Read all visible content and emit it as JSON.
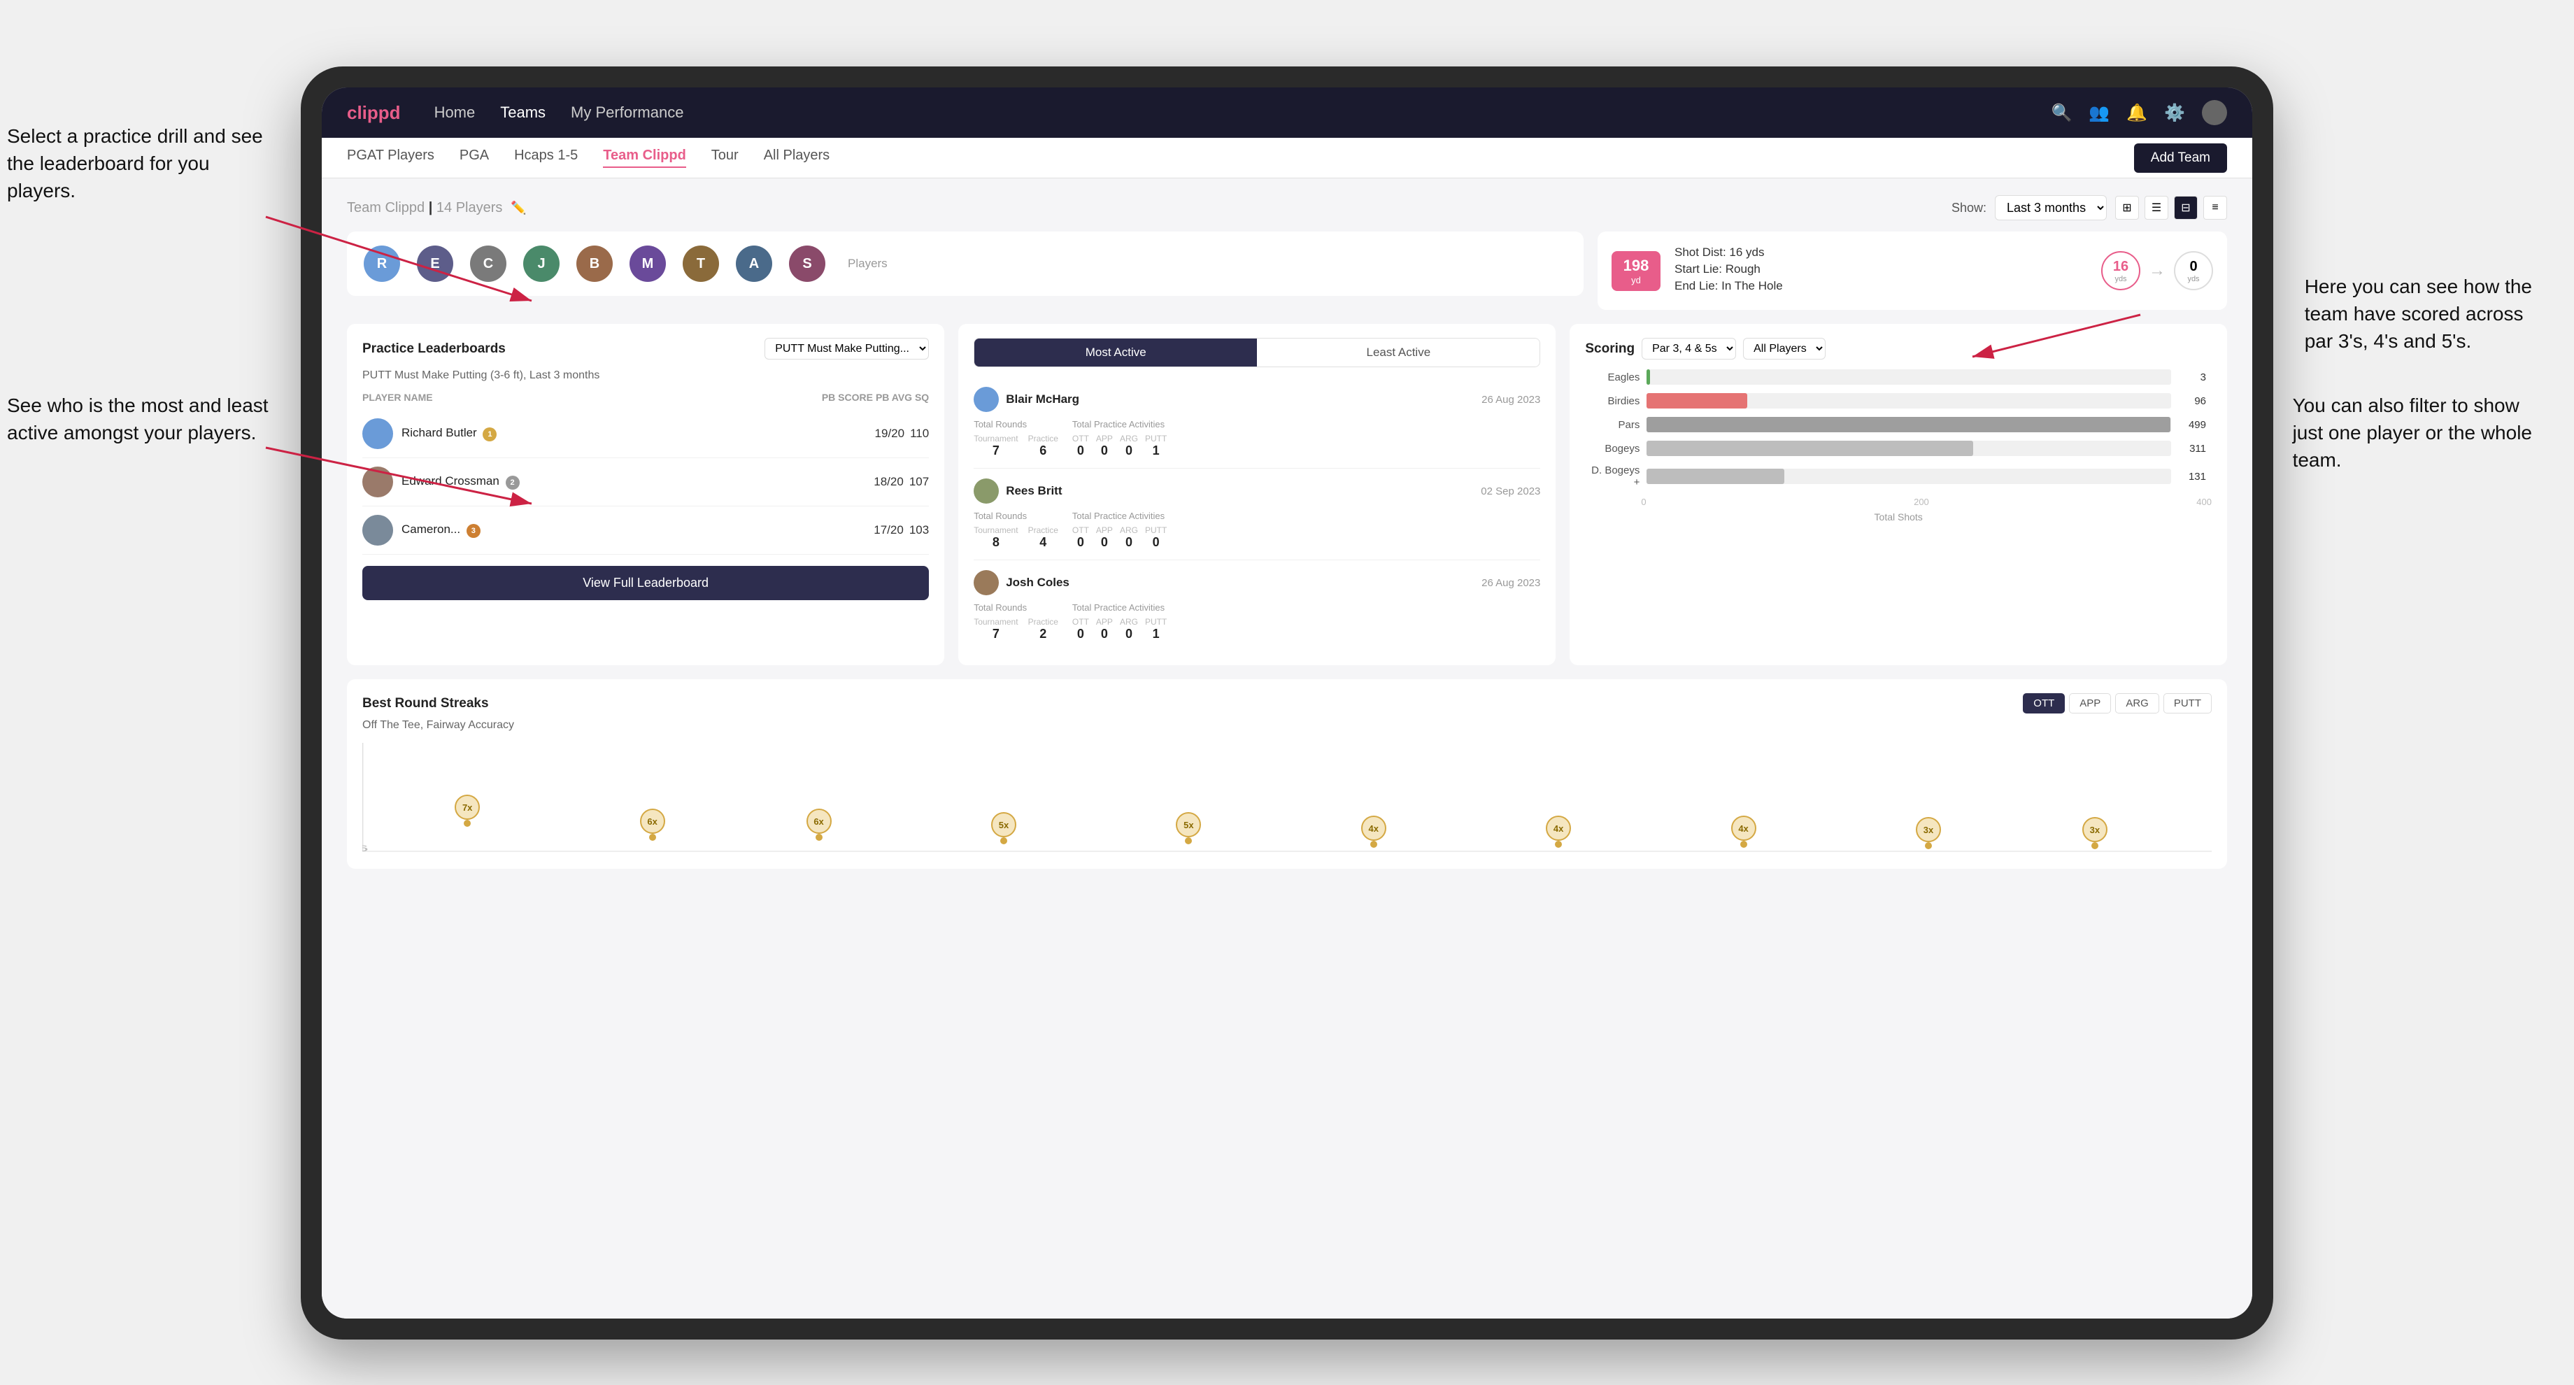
{
  "annotations": {
    "top_left": "Select a practice drill and see\nthe leaderboard for you players.",
    "bottom_left": "See who is the most and least\nactive amongst your players.",
    "top_right": "Here you can see how the\nteam have scored across\npar 3's, 4's and 5's.",
    "bottom_right": "You can also filter to show\njust one player or the whole\nteam."
  },
  "navbar": {
    "brand": "clippd",
    "links": [
      "Home",
      "Teams",
      "My Performance"
    ],
    "active_link": "Teams"
  },
  "subnav": {
    "links": [
      "PGAT Players",
      "PGA",
      "Hcaps 1-5",
      "Team Clippd",
      "Tour",
      "All Players"
    ],
    "active_link": "Team Clippd",
    "add_team_label": "Add Team"
  },
  "team_header": {
    "title": "Team Clippd",
    "player_count": "14 Players",
    "show_label": "Show:",
    "show_value": "Last 3 months"
  },
  "shot_info": {
    "distance": "198",
    "distance_unit": "yd",
    "shot_dist_label": "Shot Dist: 16 yds",
    "start_lie": "Start Lie: Rough",
    "end_lie": "End Lie: In The Hole",
    "yards_from": "16",
    "yards_to": "0"
  },
  "practice_leaderboard": {
    "title": "Practice Leaderboards",
    "dropdown_label": "PUTT Must Make Putting...",
    "subtitle": "PUTT Must Make Putting (3-6 ft),",
    "period": "Last 3 months",
    "col_player": "PLAYER NAME",
    "col_score": "PB SCORE",
    "col_avg": "PB AVG SQ",
    "players": [
      {
        "name": "Richard Butler",
        "badge": "1",
        "badge_type": "gold",
        "score": "19/20",
        "avg": "110"
      },
      {
        "name": "Edward Crossman",
        "badge": "2",
        "badge_type": "silver",
        "score": "18/20",
        "avg": "107"
      },
      {
        "name": "Cameron...",
        "badge": "3",
        "badge_type": "bronze",
        "score": "17/20",
        "avg": "103"
      }
    ],
    "view_leaderboard": "View Full Leaderboard"
  },
  "activity": {
    "toggle_active": "Most Active",
    "toggle_inactive": "Least Active",
    "players": [
      {
        "name": "Blair McHarg",
        "date": "26 Aug 2023",
        "total_rounds_label": "Total Rounds",
        "tournament_label": "Tournament",
        "practice_label": "Practice",
        "tournament_val": "7",
        "practice_val": "6",
        "total_practice_label": "Total Practice Activities",
        "ott_val": "0",
        "app_val": "0",
        "arg_val": "0",
        "putt_val": "1"
      },
      {
        "name": "Rees Britt",
        "date": "02 Sep 2023",
        "total_rounds_label": "Total Rounds",
        "tournament_label": "Tournament",
        "practice_label": "Practice",
        "tournament_val": "8",
        "practice_val": "4",
        "total_practice_label": "Total Practice Activities",
        "ott_val": "0",
        "app_val": "0",
        "arg_val": "0",
        "putt_val": "0"
      },
      {
        "name": "Josh Coles",
        "date": "26 Aug 2023",
        "total_rounds_label": "Total Rounds",
        "tournament_label": "Tournament",
        "practice_label": "Practice",
        "tournament_val": "7",
        "practice_val": "2",
        "total_practice_label": "Total Practice Activities",
        "ott_val": "0",
        "app_val": "0",
        "arg_val": "0",
        "putt_val": "1"
      }
    ]
  },
  "scoring": {
    "title": "Scoring",
    "filter_label": "Par 3, 4 & 5s",
    "player_filter": "All Players",
    "bars": [
      {
        "label": "Eagles",
        "value": 3,
        "max": 500,
        "color": "bar-eagles"
      },
      {
        "label": "Birdies",
        "value": 96,
        "max": 500,
        "color": "bar-birdies"
      },
      {
        "label": "Pars",
        "value": 499,
        "max": 500,
        "color": "bar-pars"
      },
      {
        "label": "Bogeys",
        "value": 311,
        "max": 500,
        "color": "bar-bogeys"
      },
      {
        "label": "D. Bogeys +",
        "value": 131,
        "max": 500,
        "color": "bar-bogeys"
      }
    ],
    "x_axis": [
      "0",
      "200",
      "400"
    ],
    "x_label": "Total Shots"
  },
  "best_round_streaks": {
    "title": "Best Round Streaks",
    "subtitle": "Off The Tee, Fairway Accuracy",
    "filters": [
      "OTT",
      "APP",
      "ARG",
      "PUTT"
    ],
    "active_filter": "OTT",
    "timeline_points": [
      {
        "x_pct": 6,
        "y_pct": 20,
        "label": "7x"
      },
      {
        "x_pct": 16,
        "y_pct": 55,
        "label": "6x"
      },
      {
        "x_pct": 26,
        "y_pct": 55,
        "label": "6x"
      },
      {
        "x_pct": 37,
        "y_pct": 70,
        "label": "5x"
      },
      {
        "x_pct": 47,
        "y_pct": 70,
        "label": "5x"
      },
      {
        "x_pct": 57,
        "y_pct": 78,
        "label": "4x"
      },
      {
        "x_pct": 67,
        "y_pct": 78,
        "label": "4x"
      },
      {
        "x_pct": 77,
        "y_pct": 78,
        "label": "4x"
      },
      {
        "x_pct": 87,
        "y_pct": 85,
        "label": "3x"
      },
      {
        "x_pct": 95,
        "y_pct": 85,
        "label": "3x"
      }
    ]
  }
}
